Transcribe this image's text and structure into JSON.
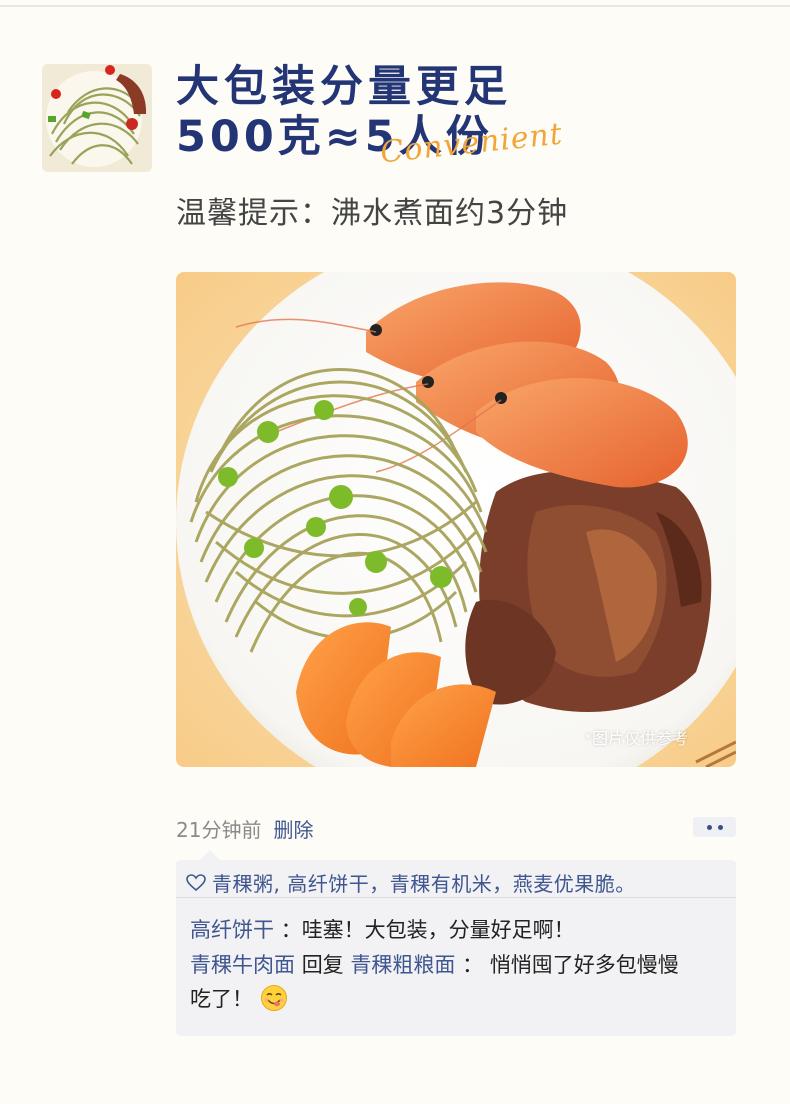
{
  "headline": {
    "line1": "大包装分量更足",
    "line2": "500克≈5人份",
    "script_word": "Convenient"
  },
  "tip": "温馨提示：沸水煮面约3分钟",
  "photo": {
    "watermark": "*图片仅供参考"
  },
  "post": {
    "time": "21分钟前",
    "delete_label": "删除"
  },
  "likes": {
    "text": "青稞粥, 高纤饼干，青稞有机米，燕麦优果脆。"
  },
  "comments": [
    {
      "author": "高纤饼干",
      "separator": "：",
      "text": "哇塞！大包装，分量好足啊！"
    },
    {
      "author": "青稞牛肉面",
      "reply_word": "回复",
      "target": "青稞粗粮面",
      "separator": "：",
      "text_line1": "悄悄囤了好多包慢慢",
      "text_line2": "吃了！"
    }
  ],
  "icons": [
    "avatar-image",
    "heart-icon",
    "more-dots-icon",
    "smile-emoji-icon"
  ],
  "colors": {
    "title": "#243576",
    "link": "#3f568f",
    "accent": "#f2a63a",
    "background": "#fdfcf6"
  }
}
